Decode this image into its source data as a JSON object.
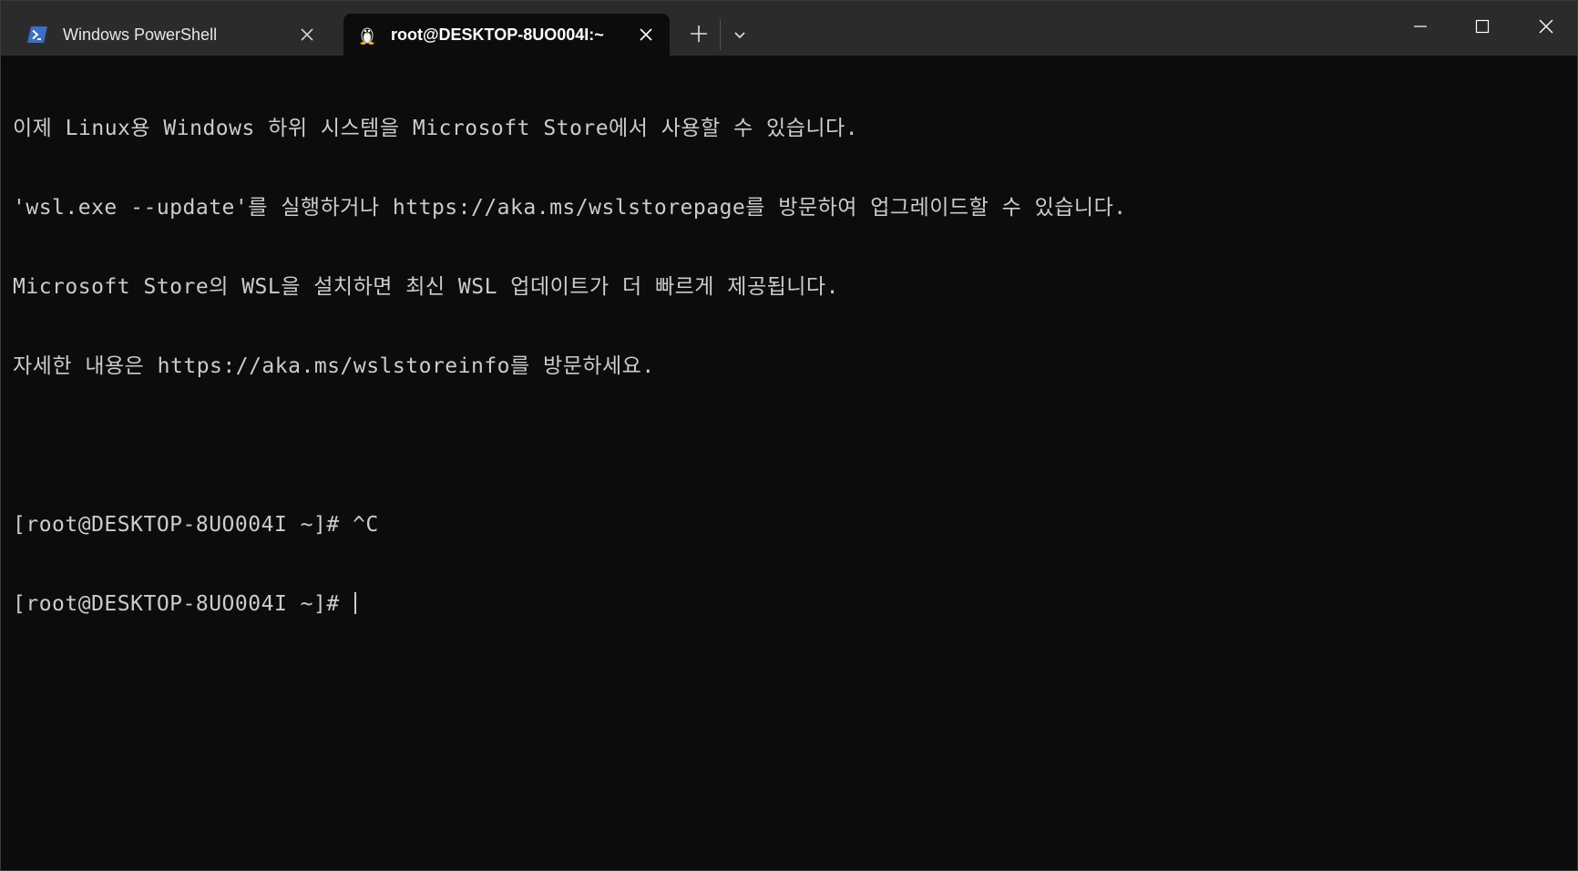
{
  "tabs": [
    {
      "title": "Windows PowerShell",
      "icon": "powershell-icon",
      "active": false
    },
    {
      "title": "root@DESKTOP-8UO004I:~",
      "icon": "linux-penguin-icon",
      "active": true
    }
  ],
  "titlebar": {
    "new_tab_icon": "plus-icon",
    "dropdown_icon": "chevron-down-icon",
    "minimize_icon": "minimize-icon",
    "maximize_icon": "maximize-icon",
    "close_icon": "close-icon"
  },
  "terminal": {
    "lines": [
      "이제 Linux용 Windows 하위 시스템을 Microsoft Store에서 사용할 수 있습니다.",
      "'wsl.exe --update'를 실행하거나 https://aka.ms/wslstorepage를 방문하여 업그레이드할 수 있습니다.",
      "Microsoft Store의 WSL을 설치하면 최신 WSL 업데이트가 더 빠르게 제공됩니다.",
      "자세한 내용은 https://aka.ms/wslstoreinfo를 방문하세요.",
      "",
      "[root@DESKTOP-8UO004I ~]# ^C"
    ],
    "prompt": "[root@DESKTOP-8UO004I ~]# "
  },
  "colors": {
    "titlebar_bg": "#2b2b2b",
    "terminal_bg": "#0c0c0c",
    "terminal_fg": "#cccccc",
    "powershell_blue": "#2c5aa0"
  }
}
